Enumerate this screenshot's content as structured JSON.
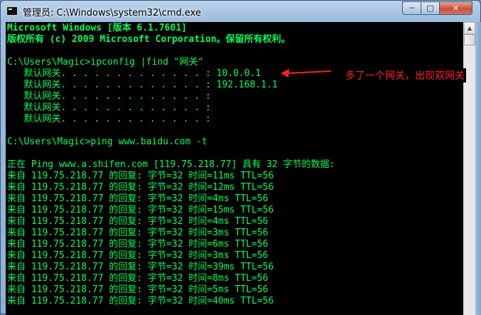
{
  "window": {
    "title": "管理员: C:\\Windows\\system32\\cmd.exe",
    "min_glyph": "─",
    "max_glyph": "□",
    "close_glyph": "✕"
  },
  "console": {
    "lines": [
      "Microsoft Windows [版本 6.1.7601]",
      "版权所有 (c) 2009 Microsoft Corporation。保留所有权利。",
      "",
      "C:\\Users\\Magic>ipconfig |find \"网关\"",
      "   默认网关. . . . . . . . . . . . . : 10.0.0.1",
      "   默认网关. . . . . . . . . . . . . : 192.168.1.1",
      "   默认网关. . . . . . . . . . . . . :",
      "   默认网关. . . . . . . . . . . . . :",
      "   默认网关. . . . . . . . . . . . . :",
      "",
      "C:\\Users\\Magic>ping www.baidu.com -t",
      "",
      "正在 Ping www.a.shifen.com [119.75.218.77] 具有 32 字节的数据:",
      "来自 119.75.218.77 的回复: 字节=32 时间=11ms TTL=56",
      "来自 119.75.218.77 的回复: 字节=32 时间=12ms TTL=56",
      "来自 119.75.218.77 的回复: 字节=32 时间=4ms TTL=56",
      "来自 119.75.218.77 的回复: 字节=32 时间=15ms TTL=56",
      "来自 119.75.218.77 的回复: 字节=32 时间=4ms TTL=56",
      "来自 119.75.218.77 的回复: 字节=32 时间=3ms TTL=56",
      "来自 119.75.218.77 的回复: 字节=32 时间=6ms TTL=56",
      "来自 119.75.218.77 的回复: 字节=32 时间=3ms TTL=56",
      "来自 119.75.218.77 的回复: 字节=32 时间=39ms TTL=56",
      "来自 119.75.218.77 的回复: 字节=32 时间=8ms TTL=56",
      "来自 119.75.218.77 的回复: 字节=32 时间=5ms TTL=56",
      "来自 119.75.218.77 的回复: 字节=32 时间=40ms TTL=56"
    ],
    "text_color": "#00ff5a",
    "background": "#000000"
  },
  "annotation": {
    "text": "多了一个网关，出现双网关",
    "color": "#ff2020"
  },
  "scrollbar": {
    "up_glyph": "▲"
  }
}
